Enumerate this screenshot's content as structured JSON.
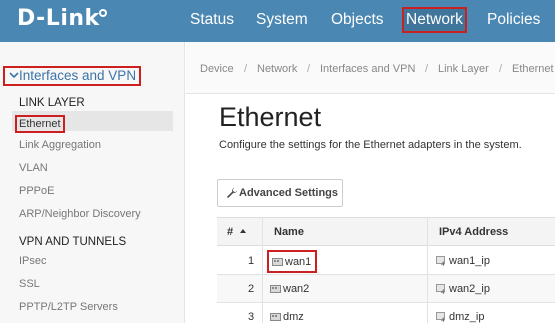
{
  "brand": {
    "logo_text": "D-Link"
  },
  "nav": {
    "items": [
      {
        "label": "Status"
      },
      {
        "label": "System"
      },
      {
        "label": "Objects"
      },
      {
        "label": "Network"
      },
      {
        "label": "Policies"
      }
    ],
    "selected": "Network"
  },
  "sidebar": {
    "group_title": "Interfaces and VPN",
    "sections": [
      {
        "heading": "LINK LAYER",
        "items": [
          "Ethernet",
          "Link Aggregation",
          "VLAN",
          "PPPoE",
          "ARP/Neighbor Discovery"
        ]
      },
      {
        "heading": "VPN AND TUNNELS",
        "items": [
          "IPsec",
          "SSL",
          "PPTP/L2TP Servers"
        ]
      }
    ],
    "active_item": "Ethernet"
  },
  "breadcrumb": [
    "Device",
    "Network",
    "Interfaces and VPN",
    "Link Layer",
    "Ethernet"
  ],
  "breadcrumb_separator": "/",
  "page": {
    "title": "Ethernet",
    "description": "Configure the settings for the Ethernet adapters in the system."
  },
  "toolbar": {
    "advanced_settings_label": "Advanced Settings"
  },
  "table": {
    "columns": [
      "#",
      "Name",
      "IPv4 Address"
    ],
    "rows": [
      {
        "num": "1",
        "name": "wan1",
        "ipv4": "wan1_ip"
      },
      {
        "num": "2",
        "name": "wan2",
        "ipv4": "wan2_ip"
      },
      {
        "num": "3",
        "name": "dmz",
        "ipv4": "dmz_ip"
      }
    ],
    "highlighted_row_name": "wan1"
  },
  "colors": {
    "header_bg": "#4a87b2",
    "highlight_box": "#cc1f1f",
    "sidebar_link": "#3c74a8"
  },
  "icons": [
    "sort-ascending-icon",
    "wrench-icon",
    "interface-icon",
    "ip-address-icon",
    "chevron-down-icon"
  ]
}
